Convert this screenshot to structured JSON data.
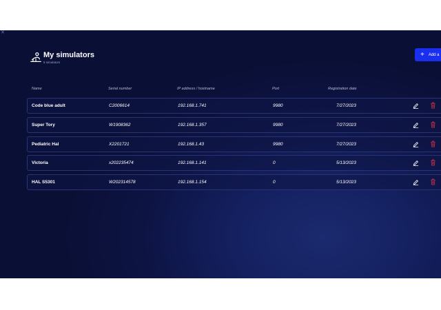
{
  "page": {
    "title": "My simulators",
    "subtitle": "5 simulators",
    "add_label": "Add a"
  },
  "table": {
    "columns": [
      "Name",
      "Serial number",
      "IP address / hostname",
      "Port",
      "Registration date"
    ],
    "rows": [
      {
        "name": "Code blue adult",
        "serial": "C2006614",
        "ip": "192.168.1.741",
        "port": "9980",
        "date": "7/27/2023"
      },
      {
        "name": "Super Tory",
        "serial": "W1908362",
        "ip": "192.168.1.357",
        "port": "9980",
        "date": "7/27/2023"
      },
      {
        "name": "Pediatric Hal",
        "serial": "X2201721",
        "ip": "192.168.1.43",
        "port": "9980",
        "date": "7/27/2023"
      },
      {
        "name": "Victoria",
        "serial": "x202235474",
        "ip": "192.168.1.141",
        "port": "0",
        "date": "5/13/2023"
      },
      {
        "name": "HAL S5301",
        "serial": "W202314578",
        "ip": "192.168.1.154",
        "port": "0",
        "date": "5/13/2023"
      }
    ]
  },
  "icons": {
    "header": "simulator-icon",
    "edit": "pencil-icon",
    "delete": "trash-icon",
    "add": "plus-icon"
  },
  "colors": {
    "background": "#0d1443",
    "accent": "#1a2ef0",
    "delete": "#c0304a",
    "text": "#ffffff"
  }
}
